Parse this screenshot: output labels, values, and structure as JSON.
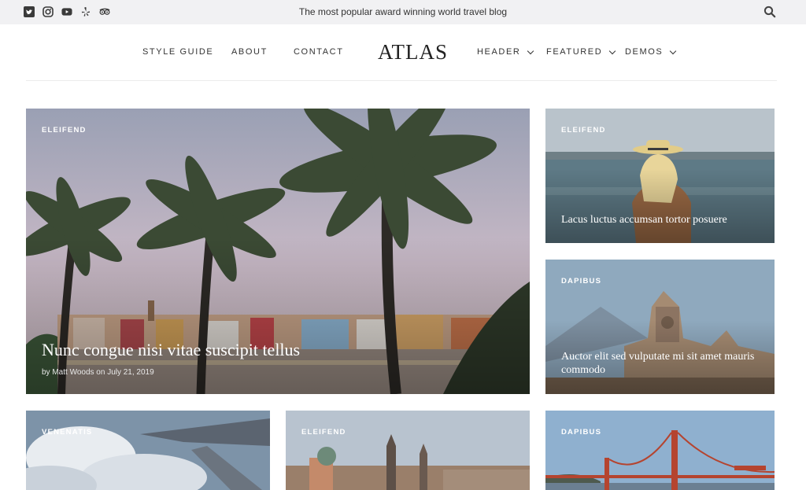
{
  "topbar": {
    "social_icons": [
      "twitter-icon",
      "instagram-icon",
      "youtube-icon",
      "yelp-icon",
      "tripadvisor-icon"
    ],
    "tagline": "The most popular award winning world travel blog",
    "search_icon": "search-icon"
  },
  "header": {
    "logo": "ATLAS",
    "nav_left": [
      "STYLE GUIDE",
      "ABOUT",
      "CONTACT"
    ],
    "nav_right": [
      "HEADER",
      "FEATURED",
      "DEMOS"
    ]
  },
  "featured": {
    "category": "ELEIFEND",
    "title": "Nunc congue nisi vitae suscipit tellus",
    "byline": "by Matt Woods on July 21, 2019"
  },
  "side_cards": [
    {
      "category": "ELEIFEND",
      "title": "Lacus luctus accumsan tortor posuere"
    },
    {
      "category": "DAPIBUS",
      "title": "Auctor elit sed vulputate mi sit amet mauris commodo"
    }
  ],
  "bottom_cards": [
    {
      "category": "VENENATIS"
    },
    {
      "category": "ELEIFEND"
    },
    {
      "category": "DAPIBUS"
    }
  ],
  "colors": {
    "topbar_bg": "#f1f1f3",
    "text": "#222222",
    "category_text": "#ffffff"
  }
}
